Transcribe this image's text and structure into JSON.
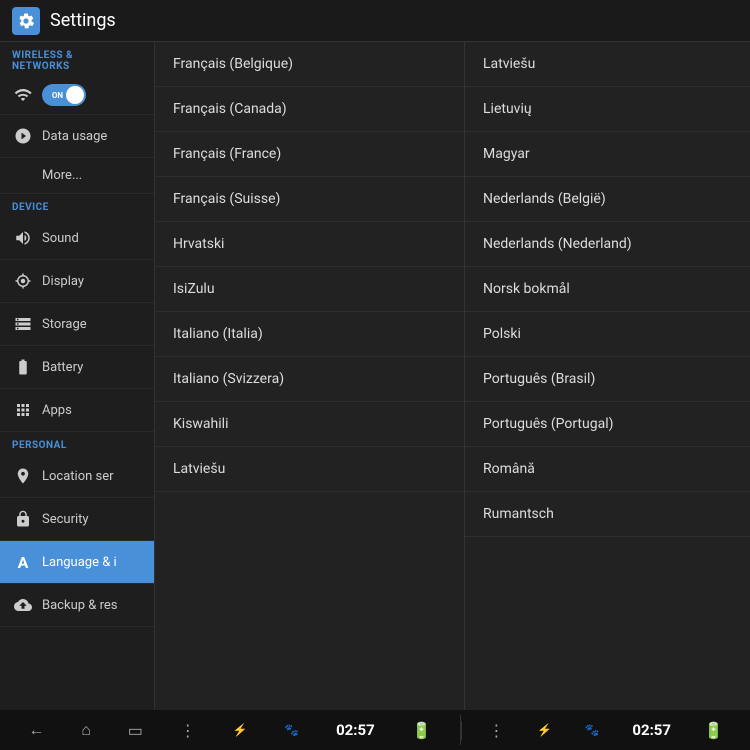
{
  "titleBar": {
    "title": "Settings",
    "iconLabel": "settings-icon"
  },
  "sidebar": {
    "sections": [
      {
        "header": "WIRELESS & NETWORKS",
        "items": [
          {
            "id": "wifi",
            "label": "Wi-Fi",
            "icon": "📶",
            "type": "toggle",
            "toggleState": "ON"
          },
          {
            "id": "data-usage",
            "label": "Data usage",
            "icon": "🌙"
          },
          {
            "id": "more",
            "label": "More...",
            "icon": "",
            "indent": true
          }
        ]
      },
      {
        "header": "DEVICE",
        "items": [
          {
            "id": "sound",
            "label": "Sound",
            "icon": "🔊"
          },
          {
            "id": "display",
            "label": "Display",
            "icon": "⚙"
          },
          {
            "id": "storage",
            "label": "Storage",
            "icon": "☰"
          },
          {
            "id": "battery",
            "label": "Battery",
            "icon": "🔋"
          },
          {
            "id": "apps",
            "label": "Apps",
            "icon": "📱"
          }
        ]
      },
      {
        "header": "PERSONAL",
        "items": [
          {
            "id": "location",
            "label": "Location ser",
            "icon": "🎯"
          },
          {
            "id": "security",
            "label": "Security",
            "icon": "🔒"
          },
          {
            "id": "language",
            "label": "Language & i",
            "icon": "A",
            "active": true
          },
          {
            "id": "backup",
            "label": "Backup & res",
            "icon": "⬆"
          }
        ]
      }
    ]
  },
  "centerColumn": {
    "languages": [
      "Français (Belgique)",
      "Français (Canada)",
      "Français (France)",
      "Français (Suisse)",
      "Hrvatski",
      "IsiZulu",
      "Italiano (Italia)",
      "Italiano (Svizzera)",
      "Kiswahili",
      "Latviešu"
    ]
  },
  "rightColumn": {
    "languages": [
      "Latviešu",
      "Lietuvių",
      "Magyar",
      "Nederlands (België)",
      "Nederlands (Nederland)",
      "Norsk bokmål",
      "Polski",
      "Português (Brasil)",
      "Português (Portugal)",
      "Română",
      "Rumantsch"
    ]
  },
  "navBar": {
    "leftIcons": [
      "←",
      "⌂",
      "▭",
      "⋮",
      "⚡"
    ],
    "rightIcons": [
      "⋮",
      "⚡"
    ],
    "time": "02:57",
    "batteryIcon": "🔋",
    "usbIcon": "⚡"
  }
}
